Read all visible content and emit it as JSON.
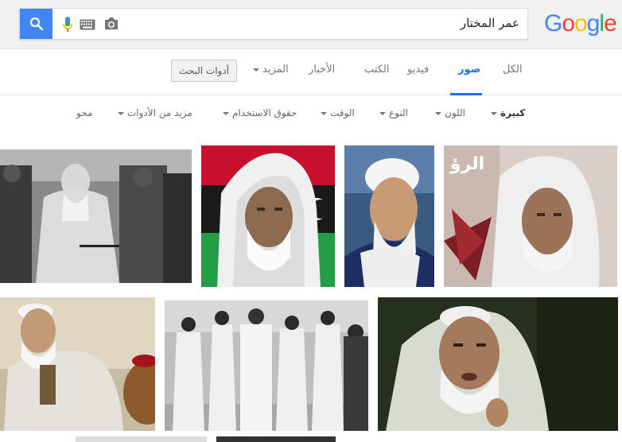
{
  "logo": {
    "letters": [
      "G",
      "o",
      "o",
      "g",
      "l",
      "e"
    ]
  },
  "search": {
    "query": "عمر المختار"
  },
  "tabs": [
    {
      "label": "الكل"
    },
    {
      "label": "صور"
    },
    {
      "label": "فيديو"
    },
    {
      "label": "الكتب"
    },
    {
      "label": "الأخبار"
    },
    {
      "label": "المزيد"
    }
  ],
  "tools_button": {
    "label": "أدوات البحث"
  },
  "filters": [
    {
      "label": "كبيرة"
    },
    {
      "label": "اللون"
    },
    {
      "label": "النوع"
    },
    {
      "label": "الوقت"
    },
    {
      "label": "حقوق الاستخدام"
    },
    {
      "label": "مزيد من الأدوات"
    },
    {
      "label": "محو"
    }
  ],
  "thumbs_text": {
    "thumb4_watermark": "الرؤ"
  },
  "colors": {
    "accent": "#1a73e8",
    "search_button": "#4285f4"
  }
}
